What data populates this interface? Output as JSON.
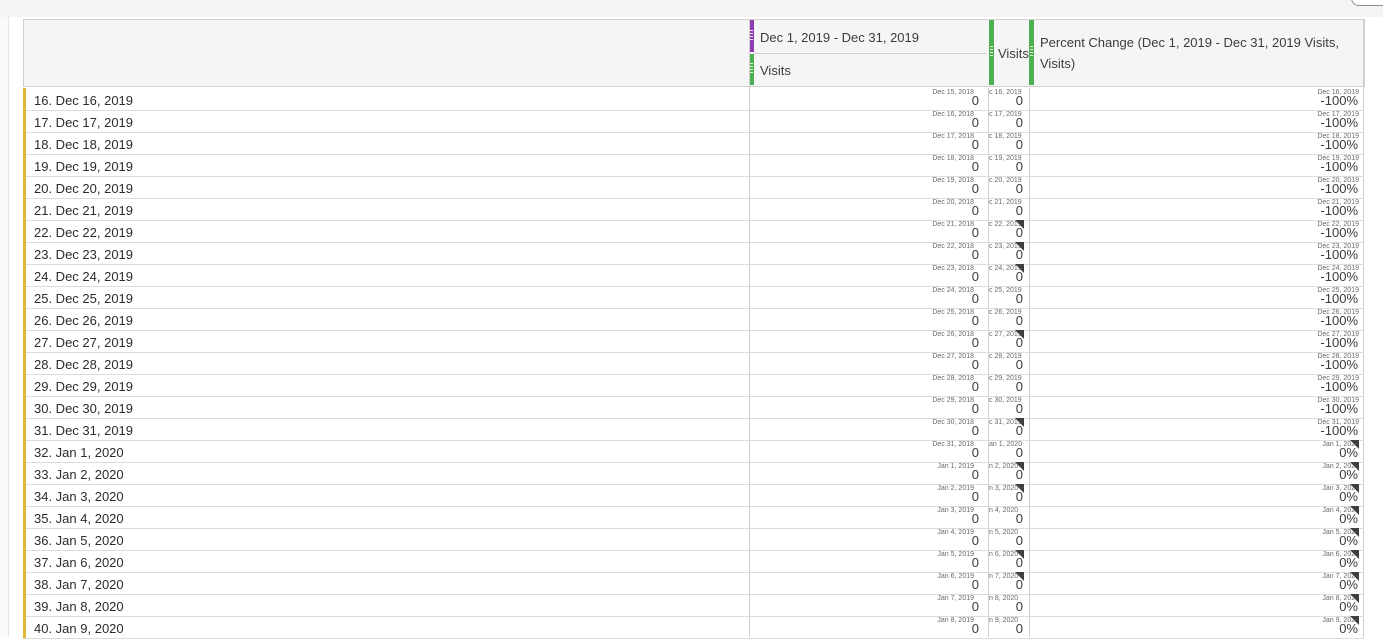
{
  "header": {
    "dimension_label": "",
    "range_label": "Dec 1, 2019 - Dec 31, 2019",
    "metric1_label": "Visits",
    "metric2_label": "Visits",
    "pct_label_line1": "Percent Change (Dec 1, 2019 - Dec 31, 2019 Visits,",
    "pct_label_line2": "Visits)"
  },
  "colors": {
    "accent_row": "#e0b83a",
    "segment_handle": "#8e3cb5",
    "metric_handle": "#4caf50",
    "anomaly_marker": "#3f3f3f"
  },
  "rows": [
    {
      "label": "16. Dec 16, 2019",
      "ref_prev": "Dec 15, 2018",
      "v1": "0",
      "ref_cur": "c 16, 2019",
      "v2": "0",
      "ref_pct": "Dec 16, 2019",
      "pct": "-100%",
      "flag_v2": false,
      "flag_pct": false
    },
    {
      "label": "17. Dec 17, 2019",
      "ref_prev": "Dec 16, 2018",
      "v1": "0",
      "ref_cur": "c 17, 2019",
      "v2": "0",
      "ref_pct": "Dec 17, 2019",
      "pct": "-100%",
      "flag_v2": false,
      "flag_pct": false
    },
    {
      "label": "18. Dec 18, 2019",
      "ref_prev": "Dec 17, 2018",
      "v1": "0",
      "ref_cur": "c 18, 2019",
      "v2": "0",
      "ref_pct": "Dec 18, 2019",
      "pct": "-100%",
      "flag_v2": false,
      "flag_pct": false
    },
    {
      "label": "19. Dec 19, 2019",
      "ref_prev": "Dec 18, 2018",
      "v1": "0",
      "ref_cur": "c 19, 2019",
      "v2": "0",
      "ref_pct": "Dec 19, 2019",
      "pct": "-100%",
      "flag_v2": false,
      "flag_pct": false
    },
    {
      "label": "20. Dec 20, 2019",
      "ref_prev": "Dec 19, 2018",
      "v1": "0",
      "ref_cur": "c 20, 2019",
      "v2": "0",
      "ref_pct": "Dec 20, 2019",
      "pct": "-100%",
      "flag_v2": false,
      "flag_pct": false
    },
    {
      "label": "21. Dec 21, 2019",
      "ref_prev": "Dec 20, 2018",
      "v1": "0",
      "ref_cur": "c 21, 2019",
      "v2": "0",
      "ref_pct": "Dec 21, 2019",
      "pct": "-100%",
      "flag_v2": false,
      "flag_pct": false
    },
    {
      "label": "22. Dec 22, 2019",
      "ref_prev": "Dec 21, 2018",
      "v1": "0",
      "ref_cur": "c 22, 2019",
      "v2": "0",
      "ref_pct": "Dec 22, 2019",
      "pct": "-100%",
      "flag_v2": true,
      "flag_pct": false
    },
    {
      "label": "23. Dec 23, 2019",
      "ref_prev": "Dec 22, 2018",
      "v1": "0",
      "ref_cur": "c 23, 2019",
      "v2": "0",
      "ref_pct": "Dec 23, 2019",
      "pct": "-100%",
      "flag_v2": true,
      "flag_pct": false
    },
    {
      "label": "24. Dec 24, 2019",
      "ref_prev": "Dec 23, 2018",
      "v1": "0",
      "ref_cur": "c 24, 2019",
      "v2": "0",
      "ref_pct": "Dec 24, 2019",
      "pct": "-100%",
      "flag_v2": true,
      "flag_pct": false
    },
    {
      "label": "25. Dec 25, 2019",
      "ref_prev": "Dec 24, 2018",
      "v1": "0",
      "ref_cur": "c 25, 2019",
      "v2": "0",
      "ref_pct": "Dec 25, 2019",
      "pct": "-100%",
      "flag_v2": false,
      "flag_pct": false
    },
    {
      "label": "26. Dec 26, 2019",
      "ref_prev": "Dec 25, 2018",
      "v1": "0",
      "ref_cur": "c 26, 2019",
      "v2": "0",
      "ref_pct": "Dec 26, 2019",
      "pct": "-100%",
      "flag_v2": false,
      "flag_pct": false
    },
    {
      "label": "27. Dec 27, 2019",
      "ref_prev": "Dec 26, 2018",
      "v1": "0",
      "ref_cur": "c 27, 2019",
      "v2": "0",
      "ref_pct": "Dec 27, 2019",
      "pct": "-100%",
      "flag_v2": true,
      "flag_pct": false
    },
    {
      "label": "28. Dec 28, 2019",
      "ref_prev": "Dec 27, 2018",
      "v1": "0",
      "ref_cur": "c 28, 2019",
      "v2": "0",
      "ref_pct": "Dec 28, 2019",
      "pct": "-100%",
      "flag_v2": false,
      "flag_pct": false
    },
    {
      "label": "29. Dec 29, 2019",
      "ref_prev": "Dec 28, 2018",
      "v1": "0",
      "ref_cur": "c 29, 2019",
      "v2": "0",
      "ref_pct": "Dec 29, 2019",
      "pct": "-100%",
      "flag_v2": false,
      "flag_pct": false
    },
    {
      "label": "30. Dec 30, 2019",
      "ref_prev": "Dec 29, 2018",
      "v1": "0",
      "ref_cur": "c 30, 2019",
      "v2": "0",
      "ref_pct": "Dec 30, 2019",
      "pct": "-100%",
      "flag_v2": false,
      "flag_pct": false
    },
    {
      "label": "31. Dec 31, 2019",
      "ref_prev": "Dec 30, 2018",
      "v1": "0",
      "ref_cur": "c 31, 2019",
      "v2": "0",
      "ref_pct": "Dec 31, 2019",
      "pct": "-100%",
      "flag_v2": true,
      "flag_pct": false
    },
    {
      "label": "32. Jan 1, 2020",
      "ref_prev": "Dec 31, 2018",
      "v1": "0",
      "ref_cur": "an 1, 2020",
      "v2": "0",
      "ref_pct": "Jan 1, 2020",
      "pct": "0%",
      "flag_v2": false,
      "flag_pct": true
    },
    {
      "label": "33. Jan 2, 2020",
      "ref_prev": "Jan 1, 2019",
      "v1": "0",
      "ref_cur": "n 2, 2020",
      "v2": "0",
      "ref_pct": "Jan 2, 2020",
      "pct": "0%",
      "flag_v2": true,
      "flag_pct": true
    },
    {
      "label": "34. Jan 3, 2020",
      "ref_prev": "Jan 2, 2019",
      "v1": "0",
      "ref_cur": "n 3, 2020",
      "v2": "0",
      "ref_pct": "Jan 3, 2020",
      "pct": "0%",
      "flag_v2": true,
      "flag_pct": true
    },
    {
      "label": "35. Jan 4, 2020",
      "ref_prev": "Jan 3, 2019",
      "v1": "0",
      "ref_cur": "n 4, 2020",
      "v2": "0",
      "ref_pct": "Jan 4, 2020",
      "pct": "0%",
      "flag_v2": false,
      "flag_pct": true
    },
    {
      "label": "36. Jan 5, 2020",
      "ref_prev": "Jan 4, 2019",
      "v1": "0",
      "ref_cur": "n 5, 2020",
      "v2": "0",
      "ref_pct": "Jan 5, 2020",
      "pct": "0%",
      "flag_v2": false,
      "flag_pct": true
    },
    {
      "label": "37. Jan 6, 2020",
      "ref_prev": "Jan 5, 2019",
      "v1": "0",
      "ref_cur": "n 6, 2020",
      "v2": "0",
      "ref_pct": "Jan 6, 2020",
      "pct": "0%",
      "flag_v2": true,
      "flag_pct": true
    },
    {
      "label": "38. Jan 7, 2020",
      "ref_prev": "Jan 6, 2019",
      "v1": "0",
      "ref_cur": "n 7, 2020",
      "v2": "0",
      "ref_pct": "Jan 7, 2020",
      "pct": "0%",
      "flag_v2": true,
      "flag_pct": true
    },
    {
      "label": "39. Jan 8, 2020",
      "ref_prev": "Jan 7, 2019",
      "v1": "0",
      "ref_cur": "n 8, 2020",
      "v2": "0",
      "ref_pct": "Jan 8, 2020",
      "pct": "0%",
      "flag_v2": false,
      "flag_pct": true
    },
    {
      "label": "40. Jan 9, 2020",
      "ref_prev": "Jan 8, 2019",
      "v1": "0",
      "ref_cur": "n 9, 2020",
      "v2": "0",
      "ref_pct": "Jan 9, 2020",
      "pct": "0%",
      "flag_v2": false,
      "flag_pct": true
    }
  ]
}
